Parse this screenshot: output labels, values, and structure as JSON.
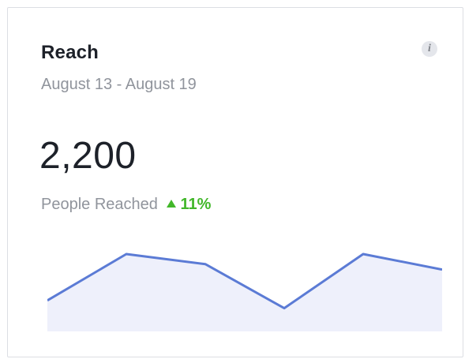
{
  "card": {
    "title": "Reach",
    "date_range": "August 13 - August 19",
    "info_icon": "info-icon",
    "metric_value": "2,200",
    "metric_label": "People Reached",
    "change": "11%",
    "change_direction": "up",
    "accent_color": "#5b7bd5",
    "fill_color": "#eef0fb",
    "positive_color": "#42b72a"
  },
  "chart_data": {
    "type": "area",
    "x": [
      1,
      2,
      3,
      4,
      5,
      6
    ],
    "values": [
      0.4,
      1.0,
      0.87,
      0.3,
      1.0,
      0.8
    ],
    "value_unit": "relative",
    "title": "",
    "xlabel": "",
    "ylabel": "",
    "grid": false
  }
}
